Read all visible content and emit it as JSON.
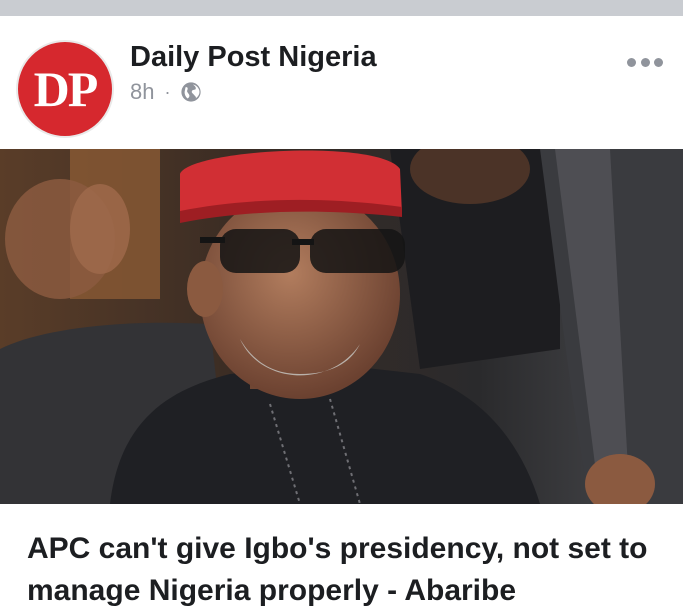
{
  "post": {
    "page_name": "Daily Post Nigeria",
    "time": "8h",
    "separator": "·",
    "privacy_icon": "globe-icon",
    "more_icon": "more-horizontal-icon",
    "avatar_text": "DP",
    "headline": "APC can't give Igbo's presidency, not set to manage Nigeria properly - Abaribe"
  },
  "colors": {
    "brand_red": "#d6282e",
    "text_primary": "#1c1e21",
    "text_secondary": "#90949c",
    "feed_background": "#c9ccd1"
  }
}
